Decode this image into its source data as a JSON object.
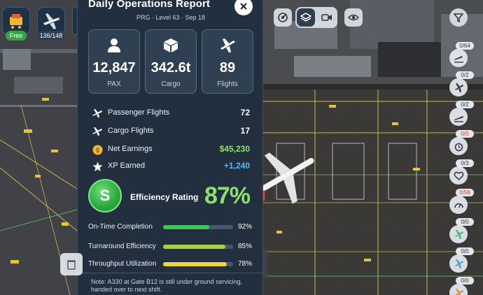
{
  "hud": {
    "shop_label": "Free",
    "fleet_count": "136/148"
  },
  "report": {
    "title": "Daily Operations Report",
    "subtitle": "PRG · Level 63 · Sep 18",
    "cards": [
      {
        "icon": "person-icon",
        "value": "12,847",
        "label": "PAX"
      },
      {
        "icon": "cargo-box-icon",
        "value": "342.6t",
        "label": "Cargo"
      },
      {
        "icon": "airplane-icon",
        "value": "89",
        "label": "Flights"
      }
    ],
    "stats": [
      {
        "icon": "airplane-icon",
        "label": "Passenger Flights",
        "value": "72",
        "color": "#ffffff"
      },
      {
        "icon": "airplane-icon",
        "label": "Cargo Flights",
        "value": "17",
        "color": "#ffffff"
      },
      {
        "icon": "coin-icon",
        "label": "Net Earnings",
        "value": "$45,230",
        "color": "#8ee06c"
      },
      {
        "icon": "star-icon",
        "label": "XP Earned",
        "value": "+1,240",
        "color": "#5cb8f5"
      }
    ],
    "efficiency": {
      "badge": "S",
      "label": "Efficiency Rating",
      "value": "87%"
    },
    "metrics": [
      {
        "label": "On-Time Completion",
        "value": "92%",
        "fraction": 0.66,
        "color": "#3cc65a"
      },
      {
        "label": "Turnaround Efficiency",
        "value": "85%",
        "fraction": 0.89,
        "color": "#a6d83a"
      },
      {
        "label": "Throughput Utilization",
        "value": "78%",
        "fraction": 0.91,
        "color": "#f2d33a"
      }
    ],
    "note": "Note: A330 at Gate B12 is still under ground servicing, handed over to next shift."
  },
  "sidebar": [
    {
      "icon": "airplane-landing-icon",
      "badge": "0/64",
      "alert": false
    },
    {
      "icon": "airplane-icon",
      "badge": "0/2",
      "alert": false
    },
    {
      "icon": "airplane-takeoff-icon",
      "badge": "0/2",
      "alert": false
    },
    {
      "icon": "alarm-clock-icon",
      "badge": "0/0",
      "alert": true
    },
    {
      "icon": "heart-icon",
      "badge": "0/3",
      "alert": false
    },
    {
      "icon": "fuel-gauge-icon",
      "badge": "0/56",
      "alert": true
    },
    {
      "icon": "airplane-green-icon",
      "badge": "0/0",
      "alert": false
    },
    {
      "icon": "airplane-blue-icon",
      "badge": "0/0",
      "alert": false
    },
    {
      "icon": "airplane-orange-icon",
      "badge": "0/0",
      "alert": false
    }
  ],
  "colors": {
    "panel_bg": "#202e40",
    "accent_green": "#8ee06c",
    "accent_blue": "#5cb8f5"
  }
}
